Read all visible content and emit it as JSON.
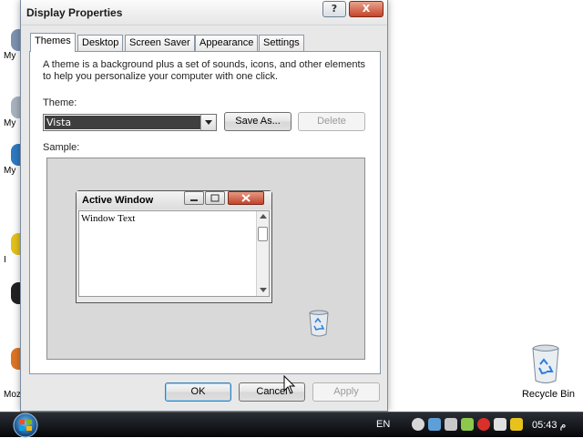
{
  "dialog": {
    "title": "Display Properties",
    "help_label": "?",
    "close_label": "X"
  },
  "tabs": [
    {
      "label": "Themes",
      "active": true
    },
    {
      "label": "Desktop"
    },
    {
      "label": "Screen Saver"
    },
    {
      "label": "Appearance"
    },
    {
      "label": "Settings"
    }
  ],
  "themes": {
    "description": "A theme is a background plus a set of sounds, icons, and other elements to help you personalize your computer with one click.",
    "theme_label": "Theme:",
    "theme_value": "Vista",
    "save_as": "Save As...",
    "delete": "Delete",
    "sample_label": "Sample:"
  },
  "sample": {
    "window_title": "Active Window",
    "window_text": "Window Text"
  },
  "footer": {
    "ok": "OK",
    "cancel": "Cancel",
    "apply": "Apply"
  },
  "desktop": {
    "icons": [
      {
        "label": "My"
      },
      {
        "label": "My"
      },
      {
        "label": "My"
      },
      {
        "label": "I"
      },
      {
        "label": "Moz"
      }
    ],
    "recycle_bin": "Recycle Bin"
  },
  "taskbar": {
    "language": "EN",
    "clock": "05:43 م"
  },
  "colors": {
    "close_red": "#c5442a",
    "taskbar_bg": "#050608",
    "selection": "#3f3f3f"
  }
}
